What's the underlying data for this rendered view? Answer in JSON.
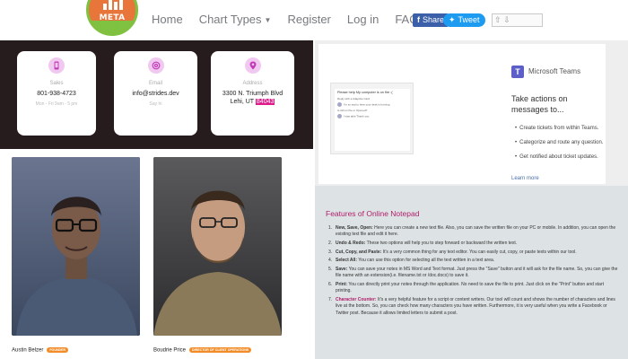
{
  "nav": {
    "logo_text": "META",
    "links": [
      "Home",
      "Chart Types",
      "Register",
      "Log in",
      "FAQ"
    ],
    "share_label": "Share",
    "tweet_label": "Tweet"
  },
  "contact": {
    "phone": {
      "label": "Sales",
      "value": "801-938-4723",
      "sub": "Mon - Fri 9am - 5 pm"
    },
    "email": {
      "label": "Email",
      "value": "info@strides.dev",
      "sub": "Say hi"
    },
    "address": {
      "label": "Address",
      "line1": "3300 N. Triumph Blvd",
      "line2_prefix": "Lehi, UT ",
      "line2_highlight": "84043"
    }
  },
  "team": [
    {
      "name": "Austin Belzer",
      "role": "FOUNDER"
    },
    {
      "name": "Boudrie Price",
      "role": "DIRECTOR OF CLIENT OPERATIONS"
    }
  ],
  "teams_ad": {
    "brand": "Microsoft Teams",
    "headline": "Take actions on messages to...",
    "bullets": [
      "Create tickets from within Teams.",
      "Categorize and route any question.",
      "Get notified about ticket updates."
    ],
    "learn_more": "Learn more",
    "shot_title": "Please help My computer is on fire :(",
    "shot_lines": [
      "Reply with a Adaptive Card",
      "I'm so sad to hear your desk is burning",
      "Is still on fire or Opened?",
      "I was able Thank you."
    ]
  },
  "notepad": {
    "title": "Features of Online Notepad",
    "items": [
      {
        "n": "1.",
        "label": "New, Save, Open:",
        "text": " Here you can create a new text file. Also, you can save the written file on your PC or mobile. In addition, you can open the existing text file and edit it here."
      },
      {
        "n": "2.",
        "label": "Undo & Redo:",
        "text": " These two options will help you to step forward or backward the written text."
      },
      {
        "n": "3.",
        "label": "Cut, Copy, and Paste:",
        "text": " It's a very common thing for any text editor. You can easily cut, copy, or paste texts within our tool."
      },
      {
        "n": "4.",
        "label": "Select All:",
        "text": " You can use this option for selecting all the text written in a text area."
      },
      {
        "n": "5.",
        "label": "Save:",
        "text": " You can save your notes in MS Word and Text format. Just press the \"Save\" button and it will ask for the file name. So, you can give the file name with an extension(i.e. filename.txt or /doc.docx) to save it."
      },
      {
        "n": "6.",
        "label": "Print:",
        "text": " You can directly print your notes through the application. No need to save the file to print. Just click on the \"Print\" button and start printing."
      },
      {
        "n": "7.",
        "label": "Character Counter:",
        "text": " It's a very helpful feature for a script or content writers. Our tool will count and shows the number of characters and lines live at the bottom. So, you can check how many characters you have written. Furthermore, it is very useful when you write a Facebook or Twitter post. Because it allows limited letters to submit a post."
      }
    ]
  },
  "colors": {
    "dark_section": "#261b1d",
    "accent_pink": "#b01e6a",
    "badge_orange": "#f28c28",
    "logo_orange": "#e8763a",
    "logo_green": "#7fc241"
  }
}
